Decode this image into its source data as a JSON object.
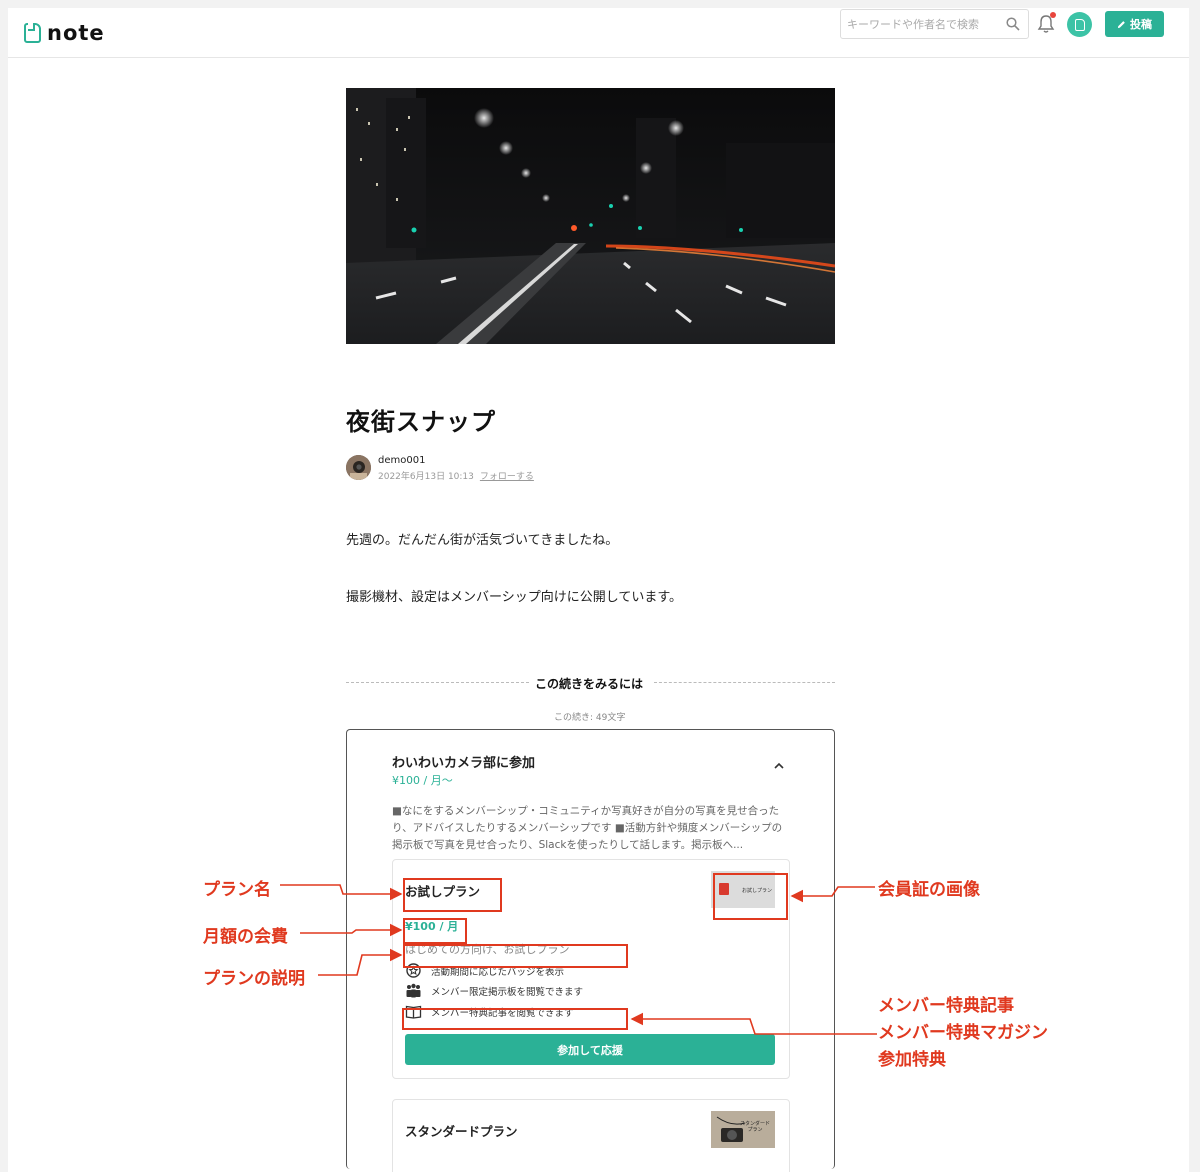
{
  "header": {
    "logo_text": "note",
    "search_placeholder": "キーワードや作者名で検索",
    "post_label": "投稿"
  },
  "article": {
    "title": "夜街スナップ",
    "author": "demo001",
    "date": "2022年6月13日 10:13",
    "follow_label": "フォローする",
    "paragraphs": [
      "先週の。だんだん街が活気づいてきましたね。",
      "撮影機材、設定はメンバーシップ向けに公開しています。"
    ]
  },
  "paywall": {
    "heading": "この続きをみるには",
    "remaining": "この続き: 49文字"
  },
  "membership": {
    "title": "わいわいカメラ部に参加",
    "price": "¥100 / 月〜",
    "description": "■なにをするメンバーシップ・コミュニティか写真好きが自分の写真を見せ合ったり、アドバイスしたりするメンバーシップです ■活動方針や頻度メンバーシップの掲示板で写真を見せ合ったり、Slackを使ったりして話します。掲示板へ...",
    "plans": [
      {
        "name": "お試しプラン",
        "thumb_text": "お試しプラン",
        "price": "¥100 / 月",
        "note": "はじめての方向け、お試しプラン",
        "benefits": [
          {
            "icon": "badge-star-icon",
            "label": "活動期間に応じたバッジを表示"
          },
          {
            "icon": "members-icon",
            "label": "メンバー限定掲示板を閲覧できます"
          },
          {
            "icon": "book-icon",
            "label": "メンバー特典記事を閲覧できます"
          }
        ],
        "cta": "参加して応援"
      },
      {
        "name": "スタンダードプラン",
        "thumb_text": "スタンダードプラン"
      }
    ]
  },
  "annotations": {
    "plan_name": "プラン名",
    "monthly_fee": "月額の会費",
    "plan_description": "プランの説明",
    "card_image": "会員証の画像",
    "benefit_article": "メンバー特典記事",
    "benefit_magazine": "メンバー特典マガジン",
    "benefit_join": "参加特典"
  },
  "colors": {
    "accent": "#2bb196",
    "annotation": "#e0391f"
  }
}
